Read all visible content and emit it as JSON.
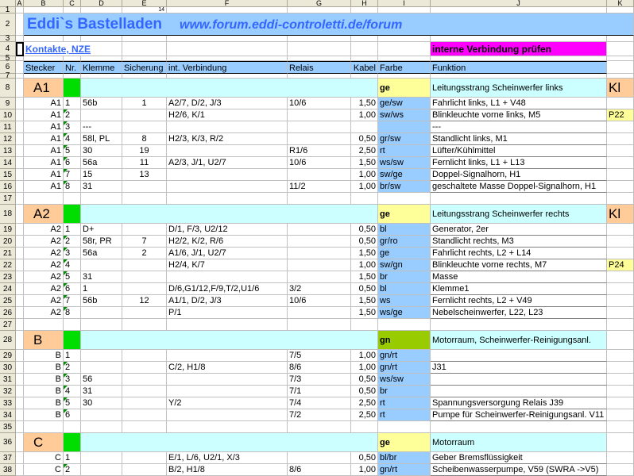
{
  "columns": [
    "A",
    "B",
    "C",
    "D",
    "E",
    "F",
    "G",
    "H",
    "I",
    "J",
    "K"
  ],
  "title": "Eddi`s Bastelladen",
  "url": "www.forum.eddi-controletti.de/forum",
  "link_text": "Kontakte, NZE",
  "check_label": "interne Verbindung prüfen",
  "row1_e_value": "14",
  "header": {
    "rownum": "6",
    "stecker": "Stecker",
    "nr": "Nr.",
    "klemme": "Klemme",
    "sicherung": "Sicherung",
    "verbindung": "int. Verbindung",
    "relais": "Relais",
    "kabel": "Kabel",
    "farbe": "Farbe",
    "funktion": "Funktion"
  },
  "row_numbers": {
    "r1": "1",
    "r2": "2",
    "r3": "3",
    "r4": "4",
    "r5": "5"
  },
  "sections": [
    {
      "rownum": "8",
      "name": "A1",
      "farbe": "ge",
      "funktion": "Leitungsstrang Scheinwerfer links",
      "k": "Kl",
      "rows": [
        {
          "n": "9",
          "s": "A1",
          "nr": "1",
          "kl": "56b",
          "si": "1",
          "v": "A2/7, D/2, J/3",
          "re": "10/6",
          "ka": "1,50",
          "fa": "ge/sw",
          "fu": "Fahrlicht links, L1 + V48",
          "k": ""
        },
        {
          "n": "10",
          "s": "A1",
          "nr": "2",
          "kl": "",
          "si": "",
          "v": "H2/6, K/1",
          "re": "",
          "ka": "1,00",
          "fa": "sw/ws",
          "fu": "Blinkleuchte vorne links, M5",
          "k": "P22"
        },
        {
          "n": "11",
          "s": "A1",
          "nr": "3",
          "kl": "---",
          "si": "",
          "v": "",
          "re": "",
          "ka": "",
          "fa": "",
          "fu": "---",
          "k": ""
        },
        {
          "n": "12",
          "s": "A1",
          "nr": "4",
          "kl": "58l, PL",
          "si": "8",
          "v": "H2/3, K/3, R/2",
          "re": "",
          "ka": "0,50",
          "fa": "gr/sw",
          "fu": "Standlicht links, M1",
          "k": ""
        },
        {
          "n": "13",
          "s": "A1",
          "nr": "5",
          "kl": "30",
          "si": "19",
          "v": "",
          "re": "R1/6",
          "ka": "2,50",
          "fa": "rt",
          "fu": "Lüfter/Kühlmittel",
          "k": ""
        },
        {
          "n": "14",
          "s": "A1",
          "nr": "6",
          "kl": "56a",
          "si": "11",
          "v": "A2/3, J/1, U2/7",
          "re": "10/6",
          "ka": "1,50",
          "fa": "ws/sw",
          "fu": "Fernlicht links, L1 + L13",
          "k": ""
        },
        {
          "n": "15",
          "s": "A1",
          "nr": "7",
          "kl": "15",
          "si": "13",
          "v": "",
          "re": "",
          "ka": "1,00",
          "fa": "sw/ge",
          "fu": "Doppel-Signalhorn, H1",
          "k": ""
        },
        {
          "n": "16",
          "s": "A1",
          "nr": "8",
          "kl": "31",
          "si": "",
          "v": "",
          "re": "11/2",
          "ka": "1,00",
          "fa": "br/sw",
          "fu": "geschaltete Masse Doppel-Signalhorn, H1",
          "k": ""
        }
      ],
      "after": "17"
    },
    {
      "rownum": "18",
      "name": "A2",
      "farbe": "ge",
      "funktion": "Leitungsstrang Scheinwerfer rechts",
      "k": "Kl",
      "rows": [
        {
          "n": "19",
          "s": "A2",
          "nr": "1",
          "kl": "D+",
          "si": "",
          "v": "D/1, F/3, U2/12",
          "re": "",
          "ka": "0,50",
          "fa": "bl",
          "fu": "Generator, 2er",
          "k": ""
        },
        {
          "n": "20",
          "s": "A2",
          "nr": "2",
          "kl": "58r, PR",
          "si": "7",
          "v": "H2/2, K/2, R/6",
          "re": "",
          "ka": "0,50",
          "fa": "gr/ro",
          "fu": "Standlicht rechts, M3",
          "k": ""
        },
        {
          "n": "21",
          "s": "A2",
          "nr": "3",
          "kl": "56a",
          "si": "2",
          "v": "A1/6, J/1, U2/7",
          "re": "",
          "ka": "1,50",
          "fa": "ge",
          "fu": "Fahrlicht rechts, L2 + L14",
          "k": ""
        },
        {
          "n": "22",
          "s": "A2",
          "nr": "4",
          "kl": "",
          "si": "",
          "v": "H2/4, K/7",
          "re": "",
          "ka": "1,00",
          "fa": "sw/gn",
          "fu": "Blinkleuchte vorne rechts, M7",
          "k": "P24"
        },
        {
          "n": "23",
          "s": "A2",
          "nr": "5",
          "kl": "31",
          "si": "",
          "v": "",
          "re": "",
          "ka": "1,50",
          "fa": "br",
          "fu": "Masse",
          "k": ""
        },
        {
          "n": "24",
          "s": "A2",
          "nr": "6",
          "kl": "1",
          "si": "",
          "v": "D/6,G1/12,F/9,T/2,U1/6",
          "re": "3/2",
          "ka": "0,50",
          "fa": "bl",
          "fu": "Klemme1",
          "k": ""
        },
        {
          "n": "25",
          "s": "A2",
          "nr": "7",
          "kl": "56b",
          "si": "12",
          "v": "A1/1, D/2, J/3",
          "re": "10/6",
          "ka": "1,50",
          "fa": "ws",
          "fu": "Fernlicht rechts, L2 + V49",
          "k": ""
        },
        {
          "n": "26",
          "s": "A2",
          "nr": "8",
          "kl": "",
          "si": "",
          "v": "P/1",
          "re": "",
          "ka": "1,50",
          "fa": "ws/ge",
          "fu": "Nebelscheinwerfer, L22, L23",
          "k": ""
        }
      ],
      "after": "27"
    },
    {
      "rownum": "28",
      "name": "B",
      "farbe": "gn",
      "funktion": "Motorraum, Scheinwerfer-Reinigungsanl.",
      "k": "",
      "rows": [
        {
          "n": "29",
          "s": "B",
          "nr": "1",
          "kl": "",
          "si": "",
          "v": "",
          "re": "7/5",
          "ka": "1,00",
          "fa": "gn/rt",
          "fu": "",
          "k": ""
        },
        {
          "n": "30",
          "s": "B",
          "nr": "2",
          "kl": "",
          "si": "",
          "v": "C/2, H1/8",
          "re": "8/6",
          "ka": "1,00",
          "fa": "gn/rt",
          "fu": "J31",
          "k": ""
        },
        {
          "n": "31",
          "s": "B",
          "nr": "3",
          "kl": "56",
          "si": "",
          "v": "",
          "re": "7/3",
          "ka": "0,50",
          "fa": "ws/sw",
          "fu": "",
          "k": ""
        },
        {
          "n": "32",
          "s": "B",
          "nr": "4",
          "kl": "31",
          "si": "",
          "v": "",
          "re": "7/1",
          "ka": "0,50",
          "fa": "br",
          "fu": "",
          "k": ""
        },
        {
          "n": "33",
          "s": "B",
          "nr": "5",
          "kl": "30",
          "si": "",
          "v": "Y/2",
          "re": "7/4",
          "ka": "2,50",
          "fa": "rt",
          "fu": "Spannungsversorgung Relais J39",
          "k": ""
        },
        {
          "n": "34",
          "s": "B",
          "nr": "6",
          "kl": "",
          "si": "",
          "v": "",
          "re": "7/2",
          "ka": "2,50",
          "fa": "rt",
          "fu": "Pumpe für Scheinwerfer-Reinigungsanl. V11",
          "k": ""
        }
      ],
      "after": "35"
    },
    {
      "rownum": "36",
      "name": "C",
      "farbe": "ge",
      "funktion": "Motorraum",
      "k": "",
      "rows": [
        {
          "n": "37",
          "s": "C",
          "nr": "1",
          "kl": "",
          "si": "",
          "v": "E/1, L/6, U2/1,  X/3",
          "re": "",
          "ka": "0,50",
          "fa": "bl/br",
          "fu": "Geber Bremsflüssigkeit",
          "k": ""
        },
        {
          "n": "38",
          "s": "C",
          "nr": "2",
          "kl": "",
          "si": "",
          "v": "B/2, H1/8",
          "re": "8/6",
          "ka": "1,00",
          "fa": "gn/rt",
          "fu": "Scheibenwasserpumpe, V59 (SWRA ->V5)",
          "k": ""
        }
      ],
      "after": ""
    }
  ]
}
